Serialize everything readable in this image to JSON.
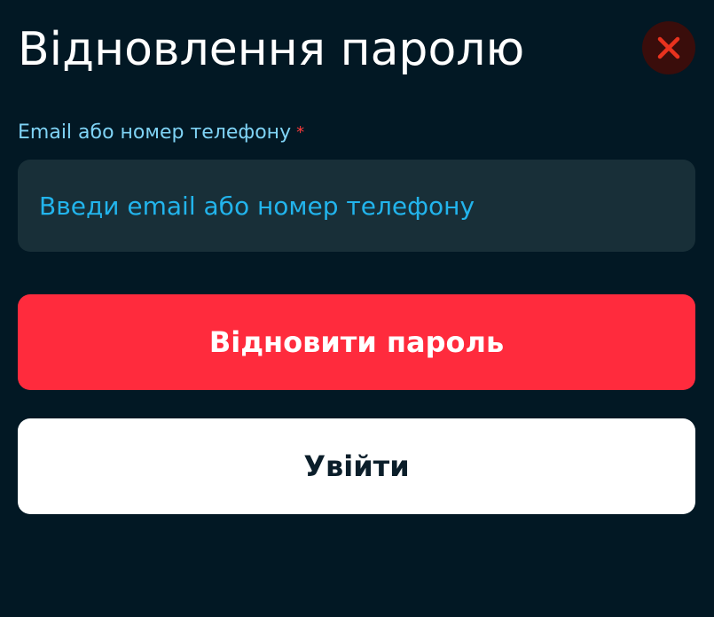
{
  "modal": {
    "title": "Відновлення паролю",
    "close_icon": "close-icon",
    "field": {
      "label": "Email або номер телефону",
      "required_marker": "*",
      "value": "",
      "placeholder": "Введи email або номер телефону"
    },
    "primary_button": "Відновити пароль",
    "secondary_button": "Увійти"
  },
  "colors": {
    "background": "#021824",
    "title": "#ffffff",
    "label": "#7fd3f5",
    "required": "#ff3b3b",
    "input_bg": "#182f38",
    "placeholder": "#22b4ec",
    "primary_bg": "#ff2b3d",
    "secondary_bg": "#ffffff",
    "close_bg": "#3a0d0b",
    "close_icon": "#e8321e"
  }
}
